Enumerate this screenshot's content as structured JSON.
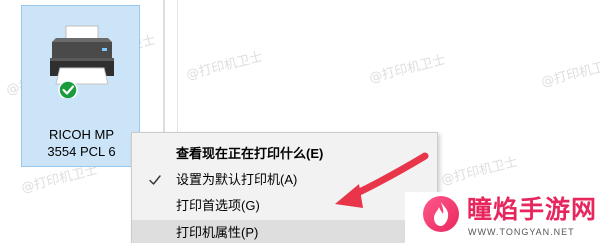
{
  "printer": {
    "name_line1": "RICOH MP",
    "name_line2": "3554 PCL 6",
    "status": "default"
  },
  "context_menu": {
    "items": [
      {
        "label": "查看现在正在打印什么(E)",
        "bold": true,
        "checked": false,
        "highlighted": false
      },
      {
        "label": "设置为默认打印机(A)",
        "bold": false,
        "checked": true,
        "highlighted": false
      },
      {
        "label": "打印首选项(G)",
        "bold": false,
        "checked": false,
        "highlighted": false
      },
      {
        "label": "打印机属性(P)",
        "bold": false,
        "checked": false,
        "highlighted": true
      }
    ]
  },
  "watermark": {
    "text_a": "@打印机卫士",
    "text_b": "@打印机卫士"
  },
  "brand": {
    "name": "瞳焰手游网",
    "url": "WWW.TONGYAN.NET"
  },
  "colors": {
    "selection_bg": "#cce4f7",
    "selection_border": "#99c9ef",
    "menu_bg": "#f2f2f2",
    "menu_highlight": "#dedede",
    "arrow": "#e8354a",
    "brand": "#e8265e",
    "check_badge": "#1a9c3c"
  }
}
